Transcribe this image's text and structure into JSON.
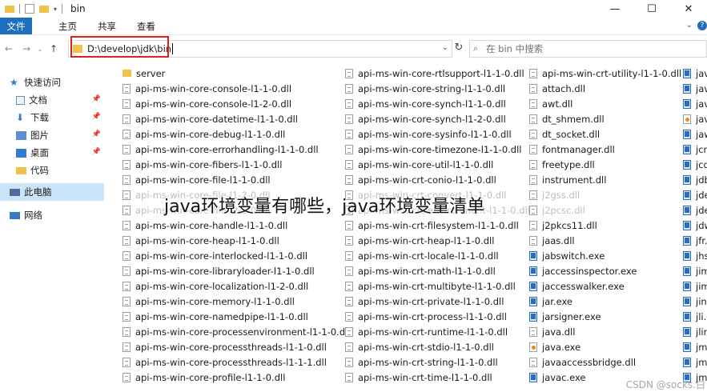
{
  "window": {
    "title": "bin",
    "controls": [
      "—",
      "☐",
      "✕"
    ]
  },
  "ribbon": {
    "file_tab": "文件",
    "tabs": [
      "主页",
      "共享",
      "查看"
    ]
  },
  "address": {
    "path": "D:\\develop\\jdk\\bin",
    "search_placeholder": "在 bin 中搜索"
  },
  "sidebar": {
    "items": [
      {
        "label": "快速访问",
        "icon": "star-icon"
      },
      {
        "label": "文档",
        "icon": "documents-icon"
      },
      {
        "label": "下载",
        "icon": "download-icon"
      },
      {
        "label": "图片",
        "icon": "pictures-icon"
      },
      {
        "label": "桌面",
        "icon": "desktop-icon"
      },
      {
        "label": "代码",
        "icon": "folder-icon"
      },
      {
        "label": "此电脑",
        "icon": "computer-icon"
      },
      {
        "label": "网络",
        "icon": "network-icon"
      }
    ]
  },
  "files": {
    "col1": [
      "server",
      "api-ms-win-core-console-l1-1-0.dll",
      "api-ms-win-core-console-l1-2-0.dll",
      "api-ms-win-core-datetime-l1-1-0.dll",
      "api-ms-win-core-debug-l1-1-0.dll",
      "api-ms-win-core-errorhandling-l1-1-0.dll",
      "api-ms-win-core-fibers-l1-1-0.dll",
      "api-ms-win-core-file-l1-1-0.dll",
      "api-ms-win-core-file-l1-2-0.dll",
      "api-ms-win-core-file-l2-1-0.dll",
      "api-ms-win-core-handle-l1-1-0.dll",
      "api-ms-win-core-heap-l1-1-0.dll",
      "api-ms-win-core-interlocked-l1-1-0.dll",
      "api-ms-win-core-libraryloader-l1-1-0.dll",
      "api-ms-win-core-localization-l1-2-0.dll",
      "api-ms-win-core-memory-l1-1-0.dll",
      "api-ms-win-core-namedpipe-l1-1-0.dll",
      "api-ms-win-core-processenvironment-l1-1-0.dll",
      "api-ms-win-core-processthreads-l1-1-0.dll",
      "api-ms-win-core-processthreads-l1-1-1.dll",
      "api-ms-win-core-profile-l1-1-0.dll"
    ],
    "col2": [
      "api-ms-win-core-rtlsupport-l1-1-0.dll",
      "api-ms-win-core-string-l1-1-0.dll",
      "api-ms-win-core-synch-l1-1-0.dll",
      "api-ms-win-core-synch-l1-2-0.dll",
      "api-ms-win-core-sysinfo-l1-1-0.dll",
      "api-ms-win-core-timezone-l1-1-0.dll",
      "api-ms-win-core-util-l1-1-0.dll",
      "api-ms-win-crt-conio-l1-1-0.dll",
      "api-ms-win-crt-convert-l1-1-0.dll",
      "api-ms-win-crt-environment-l1-1-0.dll",
      "api-ms-win-crt-filesystem-l1-1-0.dll",
      "api-ms-win-crt-heap-l1-1-0.dll",
      "api-ms-win-crt-locale-l1-1-0.dll",
      "api-ms-win-crt-math-l1-1-0.dll",
      "api-ms-win-crt-multibyte-l1-1-0.dll",
      "api-ms-win-crt-private-l1-1-0.dll",
      "api-ms-win-crt-process-l1-1-0.dll",
      "api-ms-win-crt-runtime-l1-1-0.dll",
      "api-ms-win-crt-stdio-l1-1-0.dll",
      "api-ms-win-crt-string-l1-1-0.dll",
      "api-ms-win-crt-time-l1-1-0.dll"
    ],
    "col3": [
      "api-ms-win-crt-utility-l1-1-0.dll",
      "attach.dll",
      "awt.dll",
      "dt_shmem.dll",
      "dt_socket.dll",
      "fontmanager.dll",
      "freetype.dll",
      "instrument.dll",
      "j2gss.dll",
      "j2pcsc.dll",
      "j2pkcs11.dll",
      "jaas.dll",
      "jabswitch.exe",
      "jaccessinspector.exe",
      "jaccesswalker.exe",
      "jar.exe",
      "jarsigner.exe",
      "java.dll",
      "java.exe",
      "javaaccessbridge.dll",
      "javac.exe"
    ],
    "col4": [
      "jav",
      "jav",
      "jav",
      "jav",
      "jaw",
      "jcm",
      "jco",
      "jdb",
      "jde",
      "jde",
      "jdw",
      "jfr.",
      "jhs",
      "jim",
      "jim",
      "jinf",
      "jli.c",
      "jlin",
      "jma",
      "jma",
      "jma"
    ]
  },
  "overlay": {
    "caption": "java环境变量有哪些，java环境变量清单",
    "watermark": "CSDN @socks.白"
  }
}
